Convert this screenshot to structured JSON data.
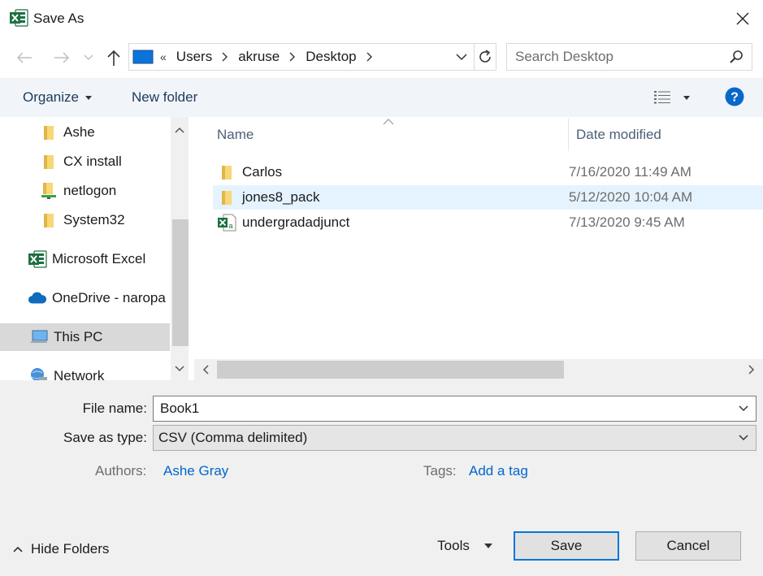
{
  "window": {
    "title": "Save As",
    "app_icon": "excel-icon",
    "close_glyph": "✕"
  },
  "nav": {
    "back_icon": "arrow-left-icon",
    "forward_icon": "arrow-right-icon",
    "up_icon": "arrow-up-icon"
  },
  "address": {
    "overflow": "«",
    "crumbs": [
      "Users",
      "akruse",
      "Desktop"
    ]
  },
  "search": {
    "placeholder": "Search Desktop"
  },
  "toolbar": {
    "organize_label": "Organize",
    "new_folder_label": "New folder",
    "help_glyph": "?"
  },
  "navpane": {
    "items": [
      {
        "label": "Ashe",
        "icon": "folder-icon"
      },
      {
        "label": "CX install",
        "icon": "folder-icon"
      },
      {
        "label": "netlogon",
        "icon": "network-folder-icon"
      },
      {
        "label": "System32",
        "icon": "folder-icon"
      },
      {
        "label": "Microsoft Excel",
        "icon": "excel-icon"
      },
      {
        "label": "OneDrive - naropa",
        "icon": "onedrive-icon"
      },
      {
        "label": "This PC",
        "icon": "computer-icon"
      },
      {
        "label": "Network",
        "icon": "network-icon"
      }
    ]
  },
  "filelist": {
    "columns": {
      "name": "Name",
      "date": "Date modified"
    },
    "rows": [
      {
        "name": "Carlos",
        "date": "7/16/2020 11:49 AM",
        "icon": "folder-icon"
      },
      {
        "name": "jones8_pack",
        "date": "5/12/2020 10:04 AM",
        "icon": "folder-icon"
      },
      {
        "name": "undergradadjunct",
        "date": "7/13/2020 9:45 AM",
        "icon": "excel-file-icon"
      }
    ]
  },
  "form": {
    "file_name_label": "File name:",
    "file_name_value": "Book1",
    "save_type_label": "Save as type:",
    "save_type_value": "CSV (Comma delimited)",
    "authors_label": "Authors:",
    "authors_value": "Ashe Gray",
    "tags_label": "Tags:",
    "tags_value": "Add a tag"
  },
  "footer": {
    "hide_folders_label": "Hide Folders",
    "tools_label": "Tools",
    "save_label": "Save",
    "cancel_label": "Cancel"
  },
  "colors": {
    "accent": "#0078d7",
    "link": "#0066cc",
    "excel_green": "#1d6f42",
    "folder_yellow": "#f8d775",
    "selection": "#e5f3ff"
  }
}
